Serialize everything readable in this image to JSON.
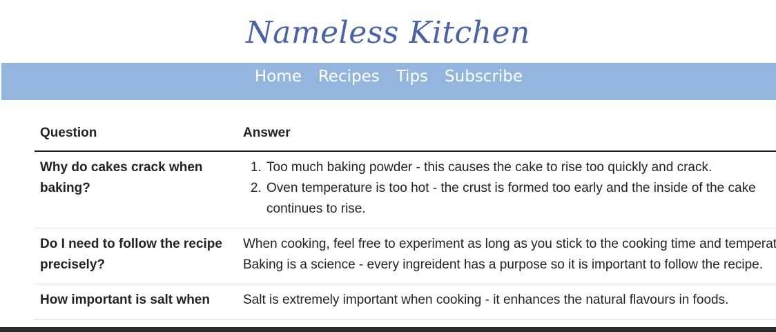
{
  "site": {
    "title": "Nameless Kitchen"
  },
  "nav": {
    "items": [
      "Home",
      "Recipes",
      "Tips",
      "Subscribe"
    ]
  },
  "table": {
    "headers": {
      "question": "Question",
      "answer": "Answer"
    },
    "rows": [
      {
        "question": "Why do cakes crack when baking?",
        "answer_list": [
          "Too much baking powder - this causes the cake to rise too quickly and crack.",
          "Oven temperature is too hot - the crust is formed too early and the inside of the cake continues to rise."
        ]
      },
      {
        "question": "Do I need to follow the recipe precisely?",
        "answer_lines": [
          "When cooking, feel free to experiment as long as you stick to the cooking time and temperature.",
          "Baking is a science - every ingreident has a purpose so it is important to follow the recipe."
        ]
      },
      {
        "question": "How important is salt when",
        "answer_lines": [
          "Salt is extremely important when cooking - it enhances the natural flavours in foods."
        ]
      }
    ]
  },
  "colors": {
    "title": "#4a63a3",
    "navbar_bg": "#94b6de",
    "nav_text": "#ffffff"
  }
}
